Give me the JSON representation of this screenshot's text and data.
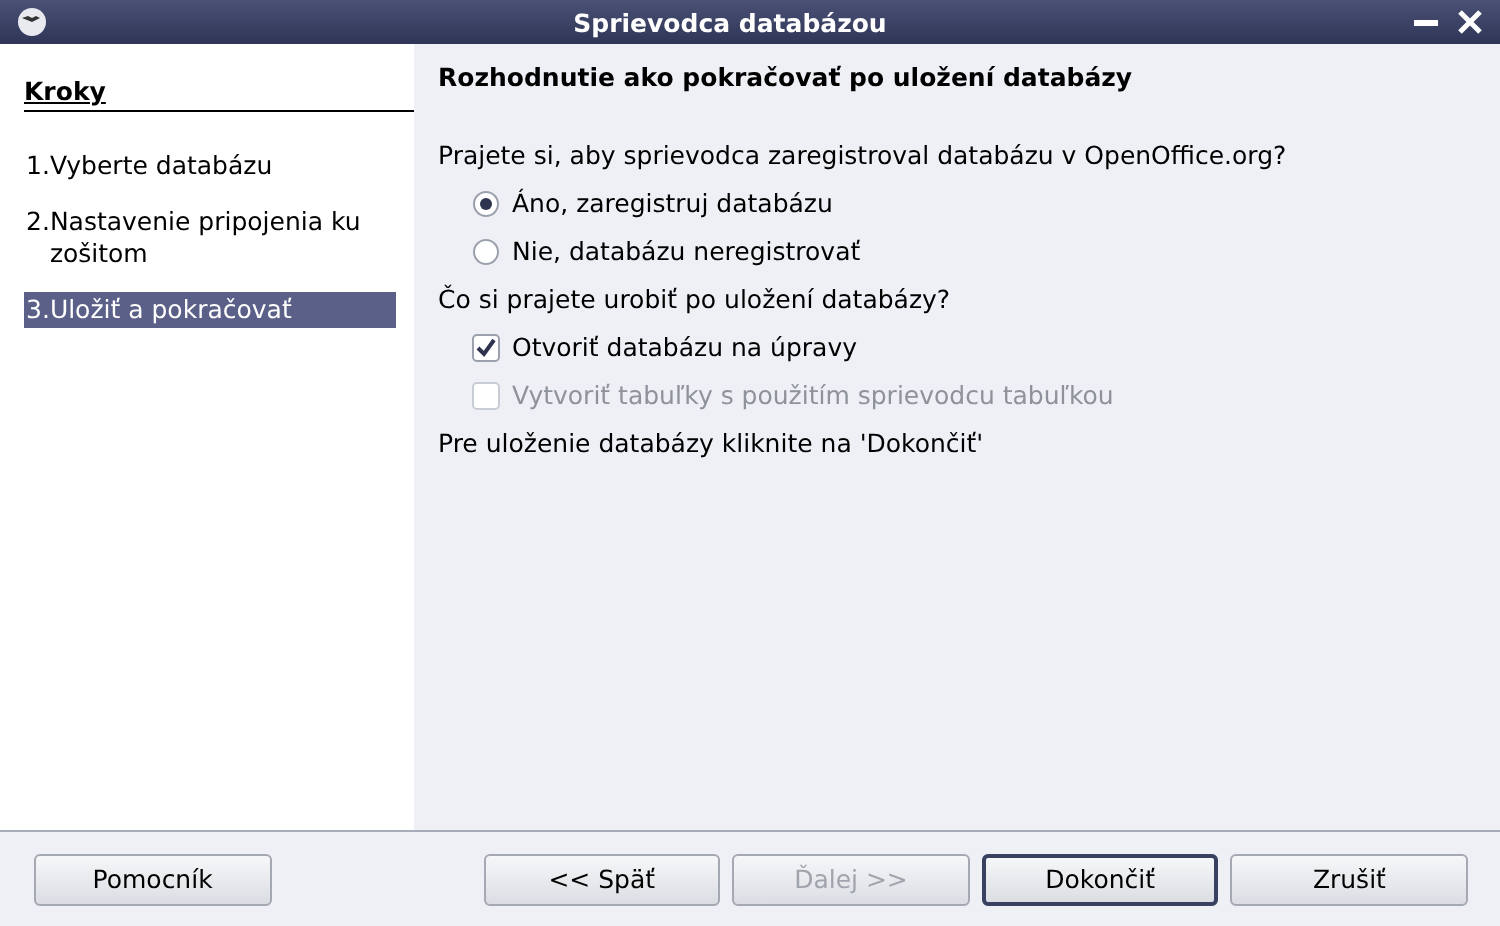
{
  "window": {
    "title": "Sprievodca databázou"
  },
  "steps": {
    "heading": "Kroky",
    "items": [
      {
        "number": "1.",
        "label": "Vyberte databázu",
        "selected": false
      },
      {
        "number": "2.",
        "label": "Nastavenie pripojenia ku zošitom",
        "selected": false
      },
      {
        "number": "3.",
        "label": "Uložiť a pokračovať",
        "selected": true
      }
    ]
  },
  "page": {
    "heading": "Rozhodnutie ako pokračovať po uložení databázy",
    "groups": [
      {
        "question": "Prajete si, aby sprievodca zaregistroval databázu v OpenOffice.org?",
        "options": [
          {
            "kind": "radio",
            "label": "Áno, zaregistruj databázu",
            "selected": true,
            "disabled": false
          },
          {
            "kind": "radio",
            "label": "Nie, databázu neregistrovať",
            "selected": false,
            "disabled": false
          }
        ]
      },
      {
        "question": "Čo si prajete urobiť po uložení databázy?",
        "options": [
          {
            "kind": "checkbox",
            "label": "Otvoriť databázu na úpravy",
            "checked": true,
            "disabled": false
          },
          {
            "kind": "checkbox",
            "label": "Vytvoriť tabuľky s použitím sprievodcu tabuľkou",
            "checked": false,
            "disabled": true
          }
        ]
      }
    ],
    "note": "Pre uloženie databázy kliknite na 'Dokončiť'"
  },
  "buttons": [
    {
      "label": "Pomocník",
      "disabled": false,
      "default": false
    },
    {
      "label": "<< Späť",
      "disabled": false,
      "default": false
    },
    {
      "label": "Ďalej >>",
      "disabled": true,
      "default": false
    },
    {
      "label": "Dokončiť",
      "disabled": false,
      "default": true
    },
    {
      "label": "Zrušiť",
      "disabled": false,
      "default": false
    }
  ]
}
